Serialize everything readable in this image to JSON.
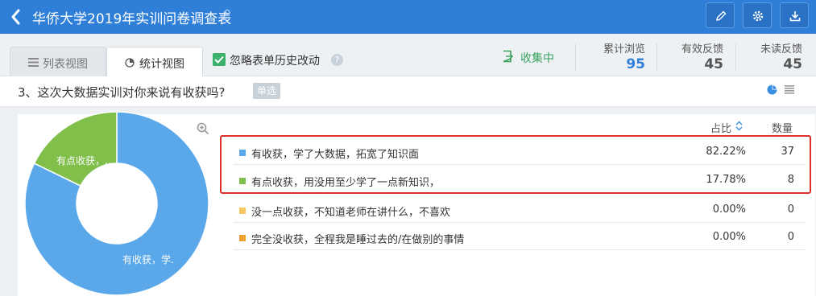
{
  "header": {
    "title": "华侨大学2019年实训问卷调查表"
  },
  "tabs": [
    {
      "label": "列表视图",
      "icon": "list-icon",
      "active": false
    },
    {
      "label": "统计视图",
      "icon": "pie-chart-icon",
      "active": true
    }
  ],
  "toolbar": {
    "ignore_history_label": "忽略表单历史改动",
    "ignore_history_checked": true,
    "collecting_label": "收集中",
    "stats": [
      {
        "label": "累计浏览",
        "value": "95"
      },
      {
        "label": "有效反馈",
        "value": "45"
      },
      {
        "label": "未读反馈",
        "value": "45"
      }
    ]
  },
  "question": {
    "text": "3、这次大数据实训对你来说有收获吗?",
    "type_badge": "单选"
  },
  "table": {
    "ratio_header": "占比",
    "count_header": "数量",
    "rows": [
      {
        "option": "有收获，学了大数据，拓宽了知识面",
        "percent": "82.22%",
        "count": "37",
        "color": "#5aa8ea"
      },
      {
        "option": "有点收获，用没用至少学了一点新知识，",
        "percent": "17.78%",
        "count": "8",
        "color": "#7fbf4a"
      },
      {
        "option": "没一点收获，不知道老师在讲什么，不喜欢",
        "percent": "0.00%",
        "count": "0",
        "color": "#f6c85f"
      },
      {
        "option": "完全没收获，全程我是睡过去的/在做别的事情",
        "percent": "0.00%",
        "count": "0",
        "color": "#f0a030"
      }
    ]
  },
  "chart_data": {
    "type": "pie",
    "categories": [
      "有收获，学了大数据，拓宽了知识面",
      "有点收获，用没用至少学了一点新知识，",
      "没一点收获，不知道老师在讲什么，不喜欢",
      "完全没收获，全程我是睡过去的/在做别的事情"
    ],
    "values": [
      37,
      8,
      0,
      0
    ],
    "slice_labels": [
      "有收获，学.",
      "有点收获，..."
    ],
    "colors": [
      "#5aa8ea",
      "#7fbf4a",
      "#f6c85f",
      "#f0a030"
    ],
    "donut": true
  },
  "highlight_color": "#e0302c"
}
